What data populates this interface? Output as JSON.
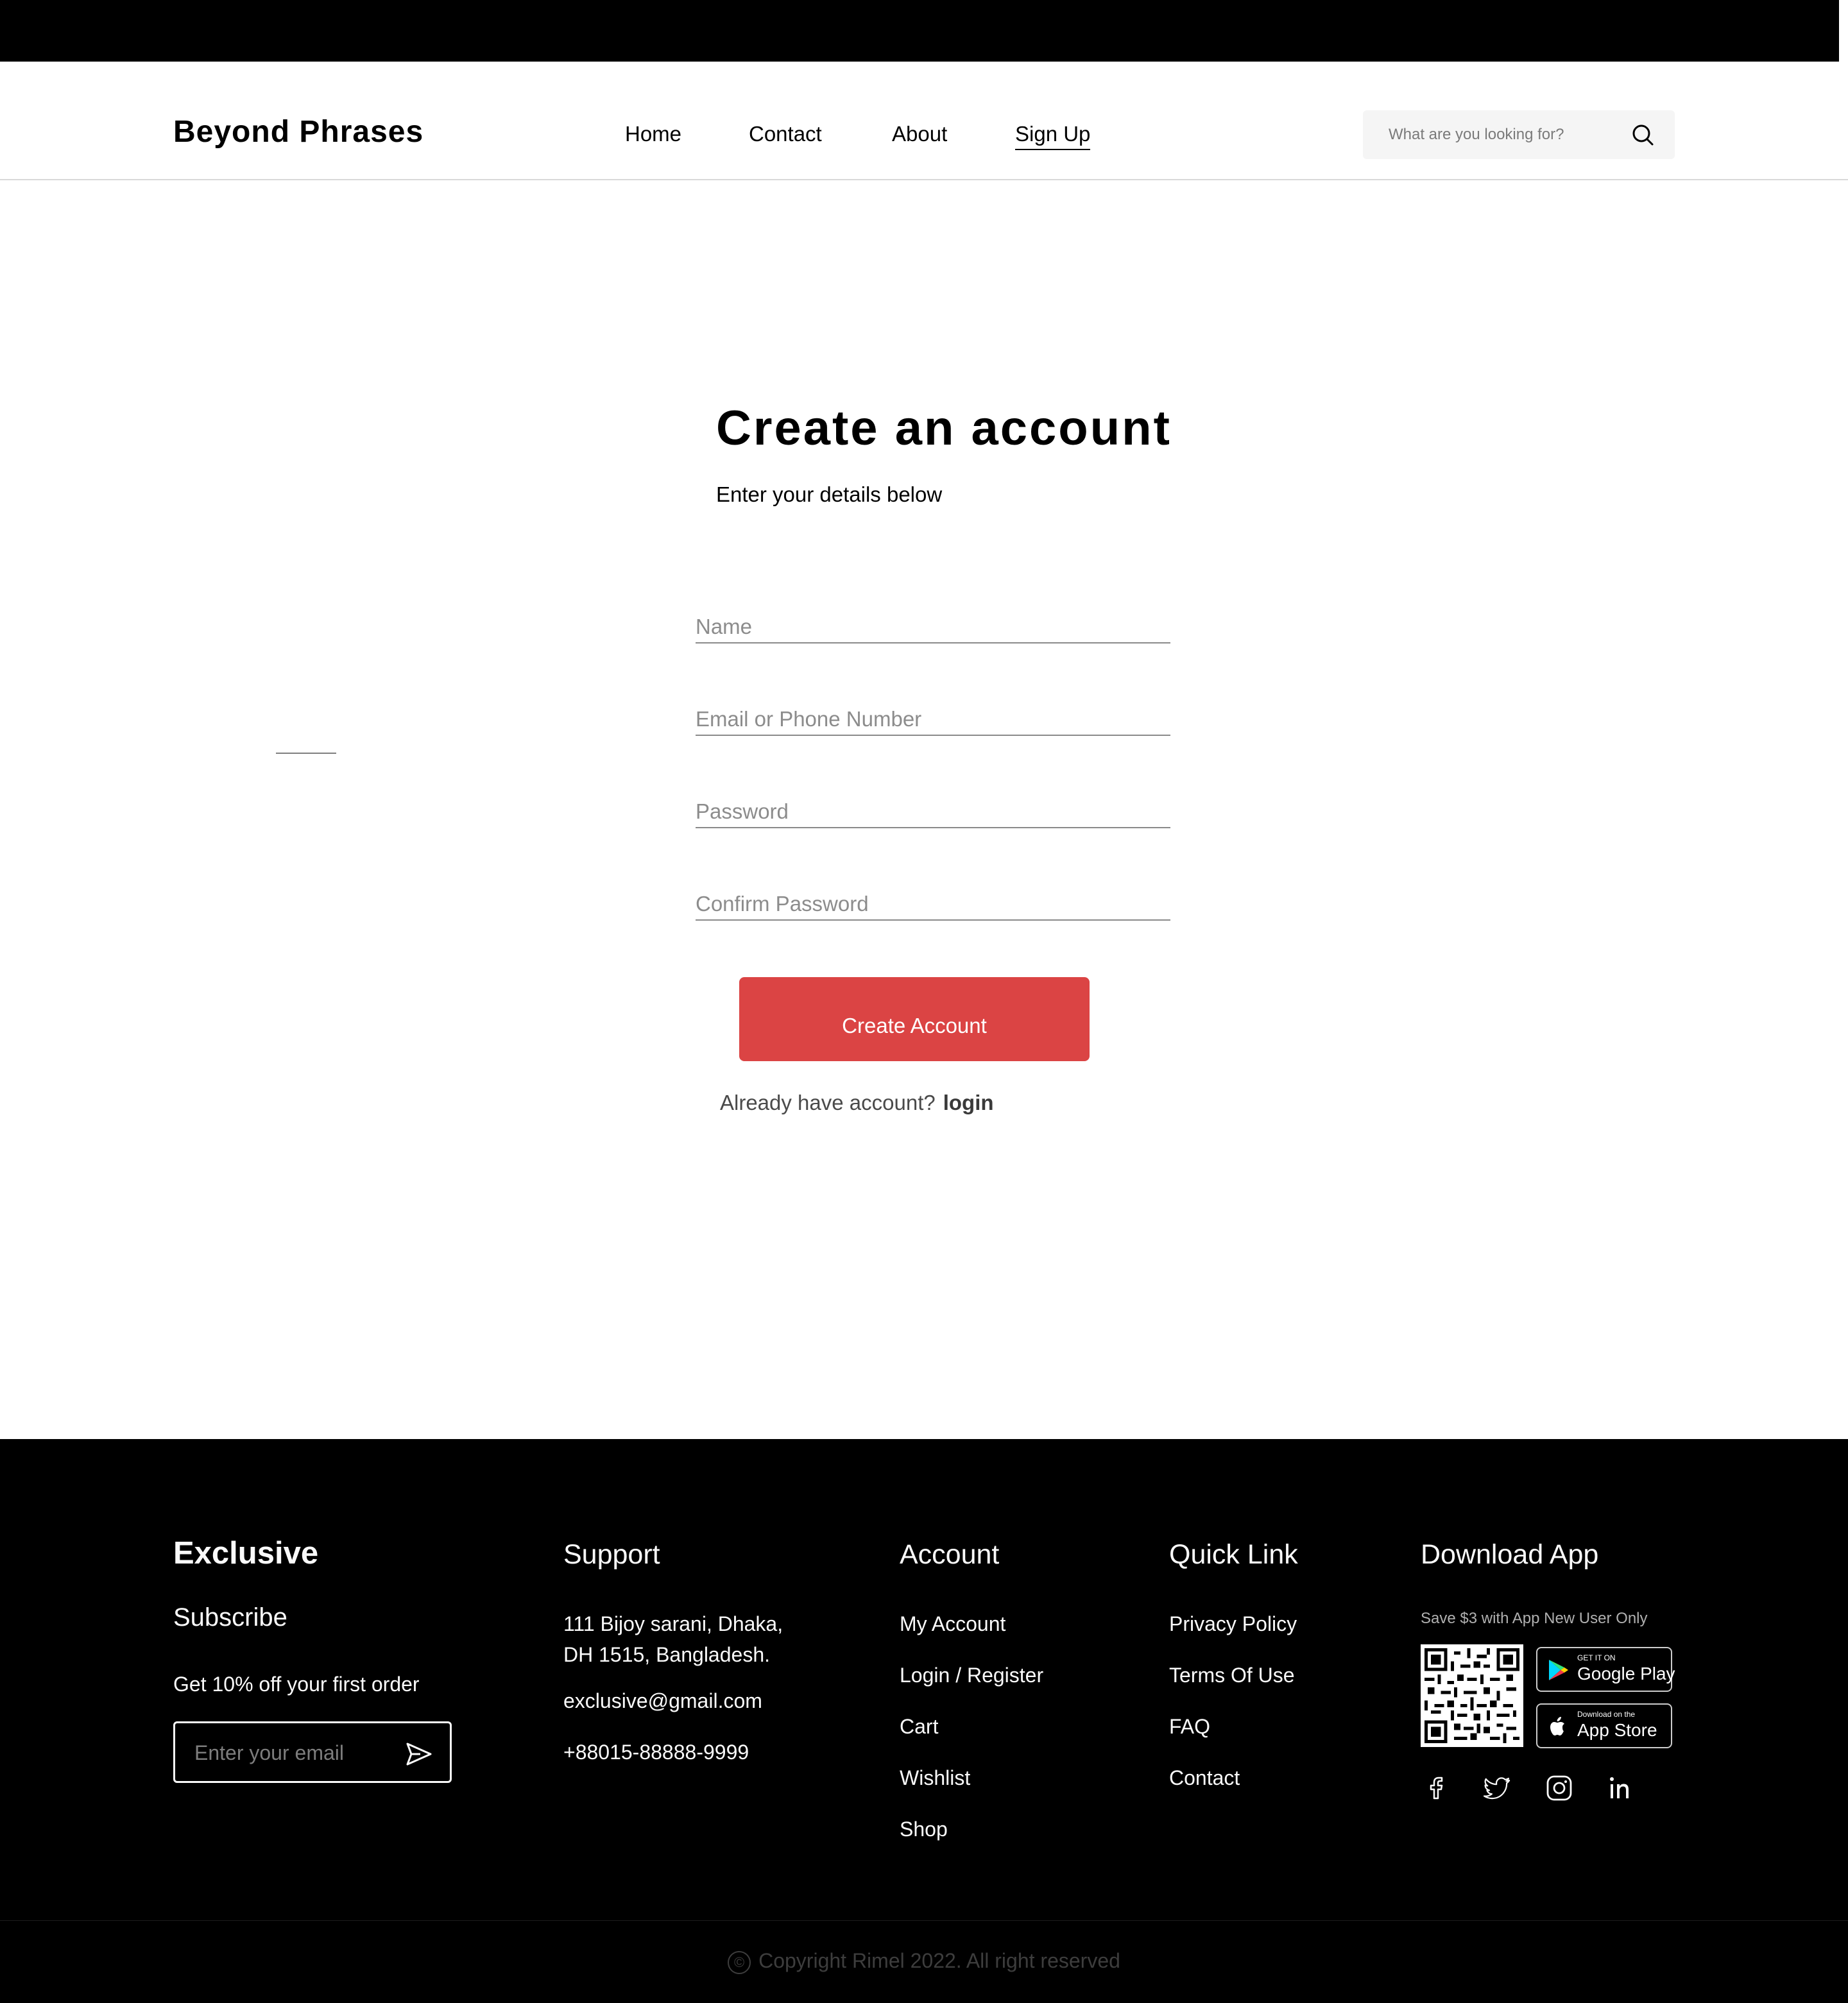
{
  "header": {
    "logo": "Beyond Phrases",
    "nav": [
      {
        "label": "Home"
      },
      {
        "label": "Contact"
      },
      {
        "label": "About"
      },
      {
        "label": "Sign Up"
      }
    ],
    "search_placeholder": "What are you looking for?"
  },
  "form": {
    "title": "Create an account",
    "subtitle": "Enter your details below",
    "fields": [
      {
        "placeholder": "Name",
        "value": ""
      },
      {
        "placeholder": "Email or Phone Number",
        "value": ""
      },
      {
        "placeholder": "Password",
        "value": ""
      },
      {
        "placeholder": "Confirm Password",
        "value": ""
      }
    ],
    "submit_label": "Create Account",
    "login_prompt": "Already have account?",
    "login_link": "login",
    "accent_color": "#DB4444"
  },
  "footer": {
    "brand": "Exclusive",
    "subscribe_title": "Subscribe",
    "subscribe_offer": "Get 10% off your first order",
    "email_placeholder": "Enter your email",
    "support": {
      "title": "Support",
      "address_line1": "111 Bijoy sarani, Dhaka,",
      "address_line2": "DH 1515, Bangladesh.",
      "email": "exclusive@gmail.com",
      "phone": "+88015-88888-9999"
    },
    "account": {
      "title": "Account",
      "links": [
        "My Account",
        "Login / Register",
        "Cart",
        "Wishlist",
        "Shop"
      ]
    },
    "quick_link": {
      "title": "Quick Link",
      "links": [
        "Privacy Policy",
        "Terms Of Use",
        "FAQ",
        "Contact"
      ]
    },
    "download": {
      "title": "Download App",
      "note": "Save $3 with App New User Only",
      "google_small": "GET IT ON",
      "google_big": "Google Play",
      "apple_small": "Download on the",
      "apple_big": "App Store"
    },
    "social_icons": [
      "facebook-icon",
      "twitter-icon",
      "instagram-icon",
      "linkedin-icon"
    ],
    "copyright": "Copyright Rimel 2022. All right reserved",
    "copyright_symbol": "©"
  }
}
